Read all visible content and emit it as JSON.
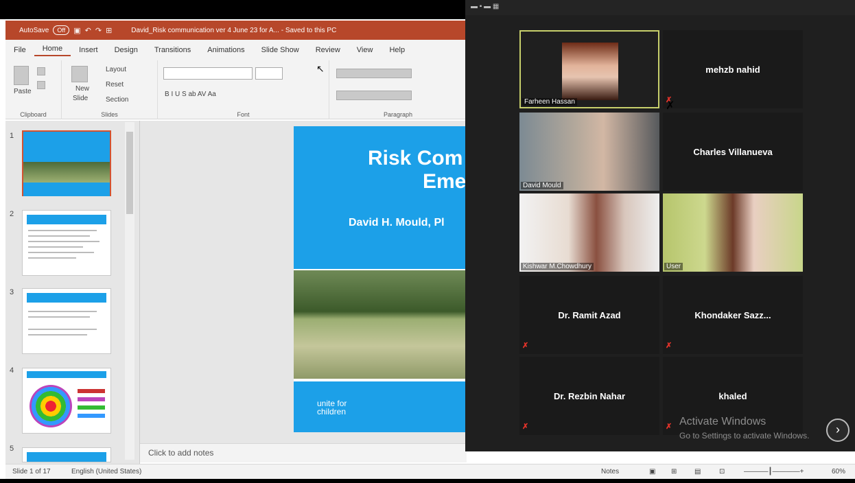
{
  "titlebar": {
    "autosave": "AutoSave",
    "toggle": "Off",
    "document": "David_Risk communication ver 4 June 23 for A...  -  Saved to this PC"
  },
  "menus": [
    "File",
    "Home",
    "Insert",
    "Design",
    "Transitions",
    "Animations",
    "Slide Show",
    "Review",
    "View",
    "Help"
  ],
  "ribbon": {
    "paste": "Paste",
    "new_slide_1": "New",
    "new_slide_2": "Slide",
    "layout": "Layout",
    "reset": "Reset",
    "section": "Section",
    "font_letters": "B  I  U  S  ab  AV  Aa",
    "group_clipboard": "Clipboard",
    "group_slides": "Slides",
    "group_font": "Font",
    "group_paragraph": "Paragraph"
  },
  "thumbnails": [
    {
      "number": "1"
    },
    {
      "number": "2"
    },
    {
      "number": "3"
    },
    {
      "number": "4"
    },
    {
      "number": "5"
    }
  ],
  "slide": {
    "title_line1": "Risk Com",
    "title_line2": "Eme",
    "author": "David H. Mould, Pl",
    "footer_line1": "unite for",
    "footer_line2": "children"
  },
  "notes_placeholder": "Click to add notes",
  "status": {
    "slide_count": "Slide 1 of 17",
    "language": "English (United States)",
    "notes": "Notes",
    "zoom_level": "60%"
  },
  "zoom": {
    "participants": [
      {
        "name": "Farheen Hassan",
        "video": true
      },
      {
        "name": "mehzb nahid",
        "video": false
      },
      {
        "name": "David Mould",
        "video": true
      },
      {
        "name": "Charles Villanueva",
        "video": false
      },
      {
        "name": "Kishwar M.Chowdhury",
        "video": true
      },
      {
        "name": "User",
        "video": true
      },
      {
        "name": "Dr. Ramit Azad",
        "video": false
      },
      {
        "name": "Khondaker  Sazz...",
        "video": false
      },
      {
        "name": "Dr. Rezbin Nahar",
        "video": false
      },
      {
        "name": "khaled",
        "video": false
      }
    ],
    "more_button": "...",
    "watermark_title": "Activate Windows",
    "watermark_sub": "Go to Settings to activate Windows."
  },
  "colors": {
    "ppt_red": "#b7472a",
    "slide_blue": "#1ca0e8",
    "zoom_bg": "#1f1f1f",
    "active_speaker": "#c8d06c"
  }
}
